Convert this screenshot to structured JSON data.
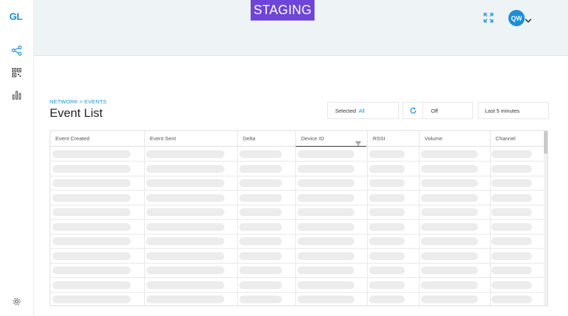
{
  "sidebar": {
    "logo": "GL",
    "items": [
      {
        "icon": "network-icon"
      },
      {
        "icon": "qr-code-icon"
      },
      {
        "icon": "bar-chart-icon"
      }
    ],
    "footer_icon": "gear-icon"
  },
  "topbar": {
    "environment_badge": "STAGING",
    "expand_icon": "fullscreen-icon",
    "user_initials": "QW"
  },
  "breadcrumb": "NETWORK > EVENTS",
  "page_title": "Event List",
  "controls": {
    "selected_label": "Selected",
    "selected_value": "All",
    "refresh_value": "Off",
    "time_range": "Last 5 minutes"
  },
  "table": {
    "columns": [
      "Event Created",
      "Event Sent",
      "Delta",
      "Device ID",
      "RSSI",
      "Volume",
      "Channel"
    ],
    "sorted_column": "Device ID",
    "loading_rows": 11
  },
  "colors": {
    "accent": "#1a8fd6",
    "staging_badge": "#6e45d9",
    "topbar_bg": "#eef3f6",
    "placeholder": "#ececec"
  }
}
